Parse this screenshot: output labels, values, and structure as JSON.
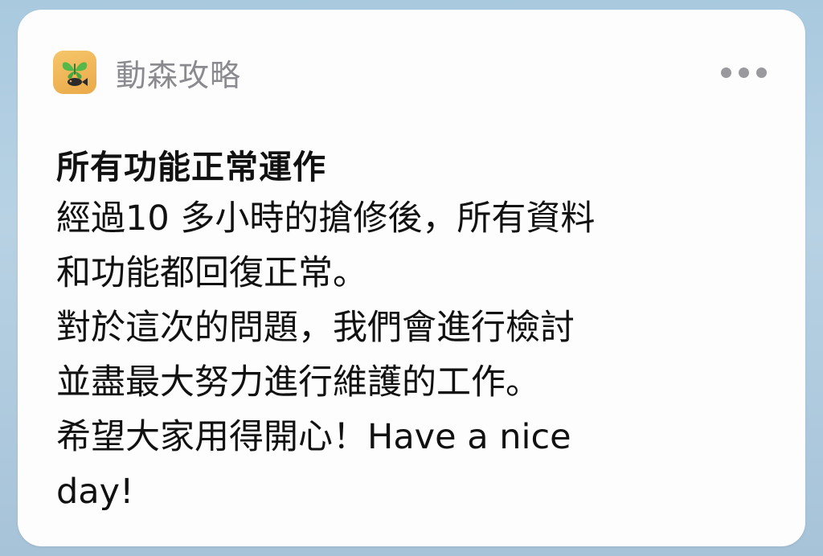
{
  "notification": {
    "app_name": "動森攻略",
    "app_icon": "butterfly-fish-icon",
    "more_icon": "ellipsis-icon",
    "title": "所有功能正常運作",
    "body_lines": [
      "經過10 多小時的搶修後，所有資料",
      "和功能都回復正常。",
      "對於這次的問題，我們會進行檢討",
      "並盡最大努力進行維護的工作。",
      "希望大家用得開心！Have a nice",
      "day!"
    ]
  },
  "colors": {
    "icon_background": "#eaa948",
    "butterfly": "#57b84a",
    "fish": "#2b2b2b",
    "app_name": "#8a8a8f",
    "more_dots": "#9a9a9e",
    "text": "#111111"
  }
}
